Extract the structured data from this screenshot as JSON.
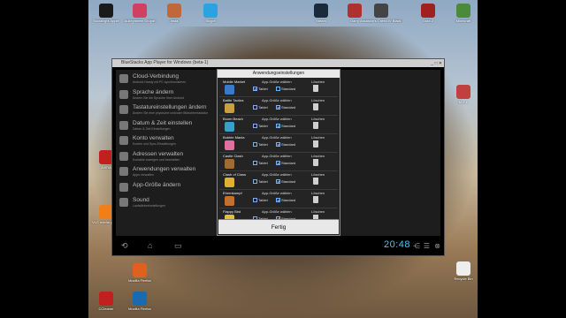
{
  "desktop": {
    "icons": [
      {
        "label": "Sociallight Apple",
        "color": "#1a1a1a"
      },
      {
        "label": "Aukeymeetr Grupdt",
        "color": "#d04060"
      },
      {
        "label": "Insta",
        "color": "#c0683a"
      },
      {
        "label": "Skype",
        "color": "#2aa3e0"
      },
      {
        "label": "Steam",
        "color": "#1a2a3a"
      },
      {
        "label": "Garry",
        "color": "#b03030"
      },
      {
        "label": "Assassin's Creed IV Black Flag",
        "color": "#444"
      },
      {
        "label": "Dota 2",
        "color": "#a02020"
      },
      {
        "label": "Minecraft",
        "color": "#4a8a3a"
      },
      {
        "label": "M.E.L",
        "color": "#c04040"
      },
      {
        "label": "AVIRA",
        "color": "#c02020"
      },
      {
        "label": "VLC media player",
        "color": "#f07f1a"
      },
      {
        "label": "Mozilla Firefox",
        "color": "#e06020"
      },
      {
        "label": "CCleaner",
        "color": "#c02020"
      },
      {
        "label": "Mozilla Firefox",
        "color": "#1a6ab0"
      },
      {
        "label": "Recycle Bin",
        "color": "#eee"
      }
    ]
  },
  "window": {
    "title": "BlueStacks App Player for Windows (beta-1)",
    "buttons": "_ □ ✕",
    "settings": [
      {
        "title": "Cloud-Verbindung",
        "sub": "Android-Handy mit PC synchronisieren"
      },
      {
        "title": "Sprache ändern",
        "sub": "Ändern Sie die Sprache Ihrer Android"
      },
      {
        "title": "Tastatureinstellungen ändern",
        "sub": "Ändern Sie eine physische und/oder Bildschirmtastatur"
      },
      {
        "title": "Datum & Zeit einstellen",
        "sub": "Datum & Zeit Einstellungen"
      },
      {
        "title": "Konto verwalten",
        "sub": "Konten und Sync-Einstellungen"
      },
      {
        "title": "Adressen verwalten",
        "sub": "Kontakte anzeigen und bearbeiten"
      },
      {
        "title": "Anwendungen verwalten",
        "sub": "Apps verwalten"
      },
      {
        "title": "App-Größe ändern",
        "sub": ""
      },
      {
        "title": "Sound",
        "sub": "Lautstärkeeinstellungen"
      }
    ],
    "clock": "20:48"
  },
  "dialog": {
    "title": "Anwendungseinstellungen",
    "col_size": "App-Größe wählen",
    "col_delete": "Löschen",
    "opt_tablet": "Tablet",
    "opt_standard": "Standard",
    "apps": [
      {
        "name": "Mobile Market",
        "color": "#3a7ac8",
        "tablet": true,
        "standard": false
      },
      {
        "name": "Battle Tactics",
        "color": "#c8a040",
        "tablet": false,
        "standard": true
      },
      {
        "name": "Boom Beach",
        "color": "#3aa0c8",
        "tablet": false,
        "standard": true
      },
      {
        "name": "Bubble Mania",
        "color": "#e070a0",
        "tablet": false,
        "standard": true
      },
      {
        "name": "Castle Clash",
        "color": "#a06a30",
        "tablet": false,
        "standard": true
      },
      {
        "name": "Clash of Clans",
        "color": "#e0b030",
        "tablet": false,
        "standard": true
      },
      {
        "name": "Ehrenkampf",
        "color": "#c07030",
        "tablet": false,
        "standard": true
      },
      {
        "name": "Flappy Bird",
        "color": "#e0c040",
        "tablet": false,
        "standard": true
      }
    ],
    "done_label": "Fertig"
  }
}
